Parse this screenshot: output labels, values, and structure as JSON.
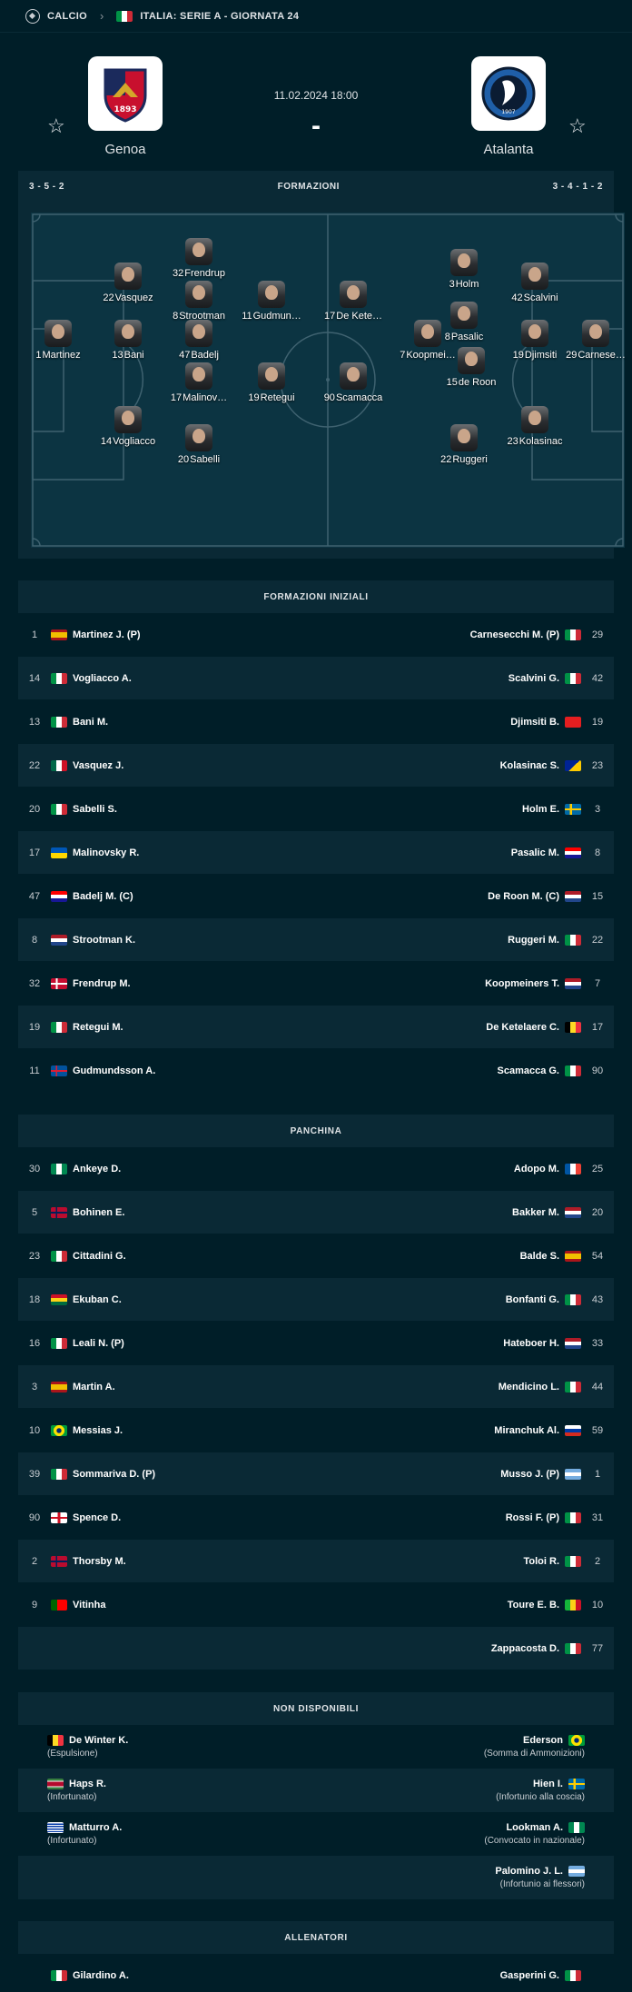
{
  "breadcrumb": {
    "sport": "CALCIO",
    "competition": "ITALIA: SERIE A - GIORNATA 24"
  },
  "match": {
    "datetime": "11.02.2024 18:00",
    "score": "-",
    "home": "Genoa",
    "away": "Atalanta"
  },
  "formation": {
    "home": "3 - 5 - 2",
    "title": "FORMAZIONI",
    "away": "3 - 4 - 1 - 2"
  },
  "pitch_players": [
    {
      "num": "32",
      "name": "Frendrup",
      "side": "home"
    },
    {
      "num": "22",
      "name": "Vasquez",
      "side": "home"
    },
    {
      "num": "8",
      "name": "Strootman",
      "side": "home"
    },
    {
      "num": "11",
      "name": "Gudmun…",
      "side": "home"
    },
    {
      "num": "1",
      "name": "Martinez",
      "side": "home"
    },
    {
      "num": "13",
      "name": "Bani",
      "side": "home"
    },
    {
      "num": "47",
      "name": "Badelj",
      "side": "home"
    },
    {
      "num": "17",
      "name": "Malinov…",
      "side": "home"
    },
    {
      "num": "19",
      "name": "Retegui",
      "side": "home"
    },
    {
      "num": "14",
      "name": "Vogliacco",
      "side": "home"
    },
    {
      "num": "20",
      "name": "Sabelli",
      "side": "home"
    },
    {
      "num": "17",
      "name": "De Kete…",
      "side": "away"
    },
    {
      "num": "3",
      "name": "Holm",
      "side": "away"
    },
    {
      "num": "42",
      "name": "Scalvini",
      "side": "away"
    },
    {
      "num": "8",
      "name": "Pasalic",
      "side": "away"
    },
    {
      "num": "7",
      "name": "Koopmei…",
      "side": "away"
    },
    {
      "num": "19",
      "name": "Djimsiti",
      "side": "away"
    },
    {
      "num": "29",
      "name": "Carnese…",
      "side": "away"
    },
    {
      "num": "15",
      "name": "de Roon",
      "side": "away"
    },
    {
      "num": "90",
      "name": "Scamacca",
      "side": "away"
    },
    {
      "num": "23",
      "name": "Kolasinac",
      "side": "away"
    },
    {
      "num": "22",
      "name": "Ruggeri",
      "side": "away"
    }
  ],
  "starting": {
    "title": "FORMAZIONI INIZIALI",
    "rows": [
      {
        "hn": "1",
        "hname": "Martinez J. (P)",
        "hflag": "es",
        "aname": "Carnesecchi M. (P)",
        "aflag": "it",
        "an": "29"
      },
      {
        "hn": "14",
        "hname": "Vogliacco A.",
        "hflag": "it",
        "aname": "Scalvini G.",
        "aflag": "it",
        "an": "42"
      },
      {
        "hn": "13",
        "hname": "Bani M.",
        "hflag": "it",
        "aname": "Djimsiti B.",
        "aflag": "al",
        "an": "19"
      },
      {
        "hn": "22",
        "hname": "Vasquez J.",
        "hflag": "mx",
        "aname": "Kolasinac S.",
        "aflag": "ba",
        "an": "23"
      },
      {
        "hn": "20",
        "hname": "Sabelli S.",
        "hflag": "it",
        "aname": "Holm E.",
        "aflag": "se",
        "an": "3"
      },
      {
        "hn": "17",
        "hname": "Malinovsky R.",
        "hflag": "ua",
        "aname": "Pasalic M.",
        "aflag": "hr",
        "an": "8"
      },
      {
        "hn": "47",
        "hname": "Badelj M. (C)",
        "hflag": "hr",
        "aname": "De Roon M. (C)",
        "aflag": "nl",
        "an": "15"
      },
      {
        "hn": "8",
        "hname": "Strootman K.",
        "hflag": "nl",
        "aname": "Ruggeri M.",
        "aflag": "it",
        "an": "22"
      },
      {
        "hn": "32",
        "hname": "Frendrup M.",
        "hflag": "dk",
        "aname": "Koopmeiners T.",
        "aflag": "nl",
        "an": "7"
      },
      {
        "hn": "19",
        "hname": "Retegui M.",
        "hflag": "it",
        "aname": "De Ketelaere C.",
        "aflag": "be",
        "an": "17"
      },
      {
        "hn": "11",
        "hname": "Gudmundsson A.",
        "hflag": "is",
        "aname": "Scamacca G.",
        "aflag": "it",
        "an": "90"
      }
    ]
  },
  "bench": {
    "title": "PANCHINA",
    "rows": [
      {
        "hn": "30",
        "hname": "Ankeye D.",
        "hflag": "ng",
        "aname": "Adopo M.",
        "aflag": "fr",
        "an": "25"
      },
      {
        "hn": "5",
        "hname": "Bohinen E.",
        "hflag": "no",
        "aname": "Bakker M.",
        "aflag": "nl",
        "an": "20"
      },
      {
        "hn": "23",
        "hname": "Cittadini G.",
        "hflag": "it",
        "aname": "Balde S.",
        "aflag": "es",
        "an": "54"
      },
      {
        "hn": "18",
        "hname": "Ekuban C.",
        "hflag": "gh",
        "aname": "Bonfanti G.",
        "aflag": "it",
        "an": "43"
      },
      {
        "hn": "16",
        "hname": "Leali N. (P)",
        "hflag": "it",
        "aname": "Hateboer H.",
        "aflag": "nl",
        "an": "33"
      },
      {
        "hn": "3",
        "hname": "Martin A.",
        "hflag": "es",
        "aname": "Mendicino L.",
        "aflag": "it",
        "an": "44"
      },
      {
        "hn": "10",
        "hname": "Messias J.",
        "hflag": "br",
        "aname": "Miranchuk Al.",
        "aflag": "ru",
        "an": "59"
      },
      {
        "hn": "39",
        "hname": "Sommariva D. (P)",
        "hflag": "it",
        "aname": "Musso J. (P)",
        "aflag": "ar",
        "an": "1"
      },
      {
        "hn": "90",
        "hname": "Spence D.",
        "hflag": "en",
        "aname": "Rossi F. (P)",
        "aflag": "it",
        "an": "31"
      },
      {
        "hn": "2",
        "hname": "Thorsby M.",
        "hflag": "no",
        "aname": "Toloi R.",
        "aflag": "it",
        "an": "2"
      },
      {
        "hn": "9",
        "hname": "Vitinha",
        "hflag": "pt",
        "aname": "Toure E. B.",
        "aflag": "ml",
        "an": "10"
      },
      {
        "hn": "",
        "hname": "",
        "hflag": "",
        "aname": "Zappacosta D.",
        "aflag": "it",
        "an": "77"
      }
    ]
  },
  "unavailable": {
    "title": "NON DISPONIBILI",
    "rows": [
      {
        "hname": "De Winter K.",
        "hflag": "be",
        "hwhy": "(Espulsione)",
        "aname": "Ederson",
        "aflag": "br",
        "awhy": "(Somma di Ammonizioni)"
      },
      {
        "hname": "Haps R.",
        "hflag": "sr",
        "hwhy": "(Infortunato)",
        "aname": "Hien I.",
        "aflag": "se",
        "awhy": "(Infortunio alla coscia)"
      },
      {
        "hname": "Matturro A.",
        "hflag": "uy",
        "hwhy": "(Infortunato)",
        "aname": "Lookman A.",
        "aflag": "ng",
        "awhy": "(Convocato in nazionale)"
      },
      {
        "hname": "",
        "hflag": "",
        "hwhy": "",
        "aname": "Palomino J. L.",
        "aflag": "ar",
        "awhy": "(Infortunio ai flessori)"
      }
    ]
  },
  "coaches": {
    "title": "ALLENATORI",
    "home": "Gilardino A.",
    "hflag": "it",
    "away": "Gasperini G.",
    "aflag": "it"
  }
}
